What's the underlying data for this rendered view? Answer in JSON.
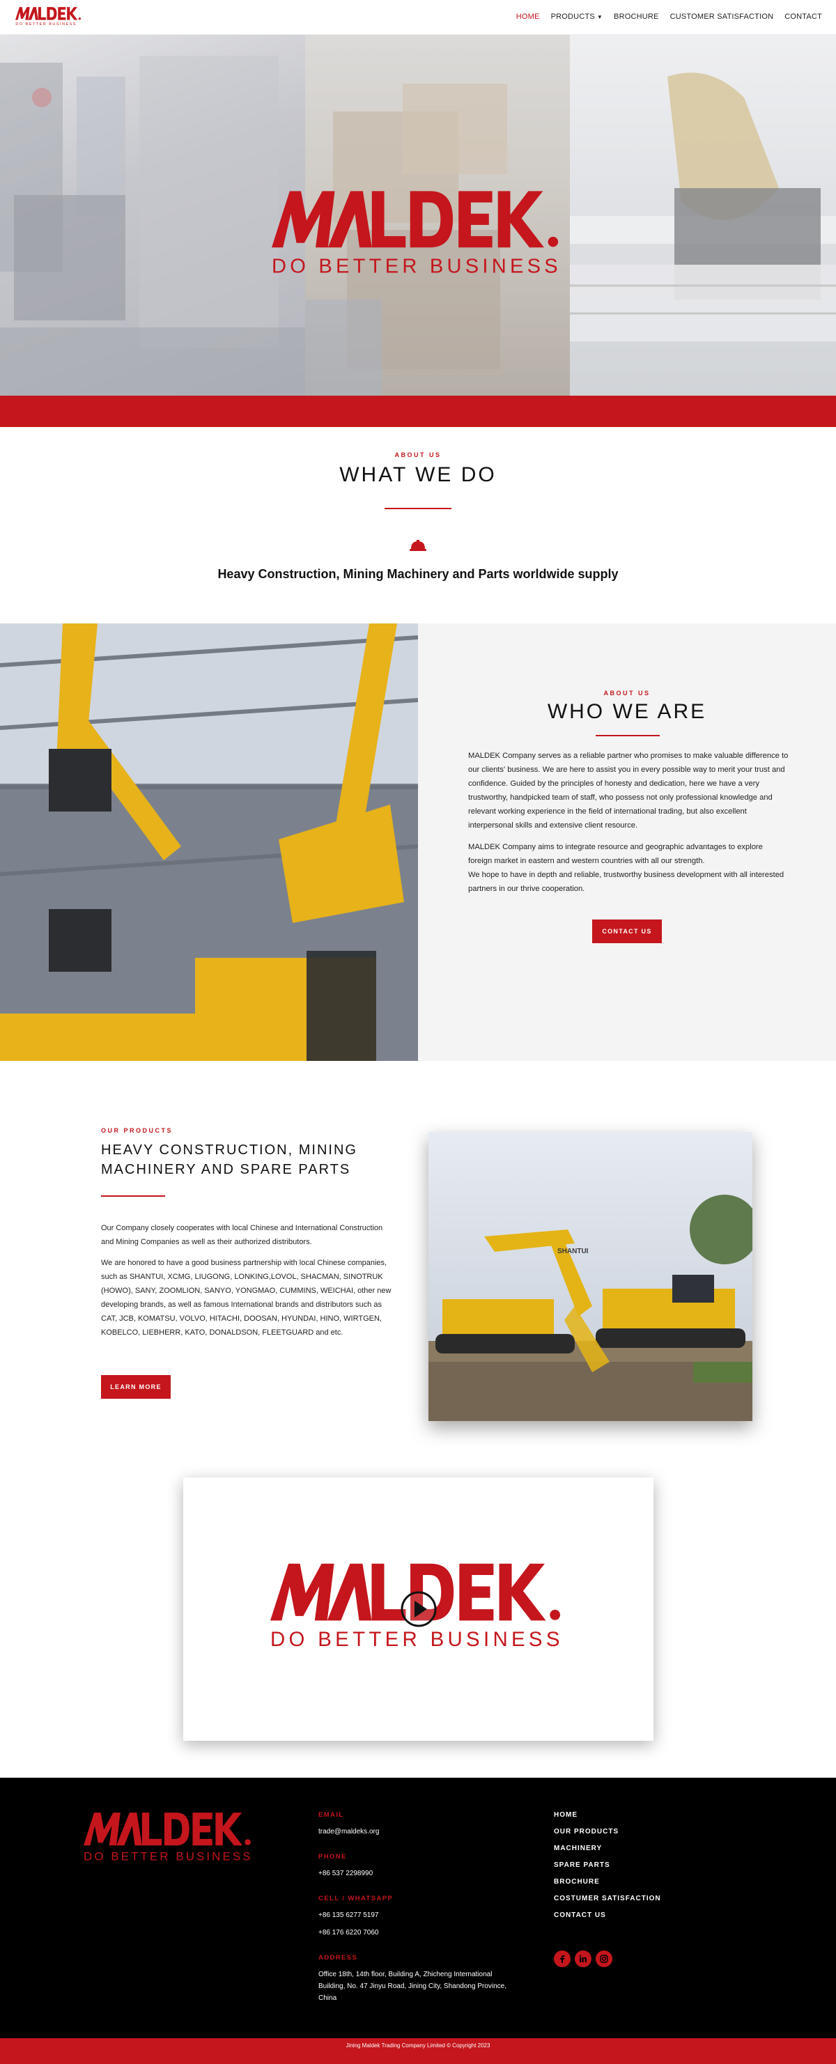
{
  "brand": {
    "logo_text": "MALDEK",
    "logo_tagline": "DO BETTER BUSINESS",
    "accent_color": "#c4161c"
  },
  "nav": {
    "items": [
      {
        "label": "HOME",
        "active": true
      },
      {
        "label": "PRODUCTS",
        "has_dropdown": true
      },
      {
        "label": "BROCHURE"
      },
      {
        "label": "CUSTOMER SATISFACTION"
      },
      {
        "label": "CONTACT"
      }
    ]
  },
  "about": {
    "eyebrow": "ABOUT US",
    "title": "WHAT WE DO",
    "icon": "helmet-icon",
    "tagline": "Heavy Construction, Mining Machinery and Parts worldwide supply"
  },
  "who": {
    "eyebrow": "ABOUT US",
    "title": "WHO WE ARE",
    "paragraphs": [
      "MALDEK Company serves as a reliable partner who promises to make valuable difference to our clients' business. We are here to assist you in every possible way to merit your trust and confidence. Guided by the principles of honesty and dedication, here we have a very trustworthy, handpicked team of staff, who possess not only professional knowledge and relevant working experience in the field of international trading, but also excellent interpersonal skills and extensive client resource.",
      "MALDEK Company aims to integrate resource and geographic advantages to explore foreign market in eastern and western countries with all our strength.",
      "We hope to have in depth and reliable, trustworthy business development with all interested partners in our thrive cooperation."
    ],
    "button": "CONTACT US"
  },
  "products": {
    "eyebrow": "OUR PRODUCTS",
    "title": "HEAVY CONSTRUCTION, MINING MACHINERY AND SPARE PARTS",
    "paragraphs": [
      "Our Company closely cooperates with local Chinese and International Construction and Mining Companies as well as their authorized distributors.",
      "We are honored to have a good business partnership with local Chinese companies, such as SHANTUI, XCMG, LIUGONG, LONKING,LOVOL, SHACMAN, SINOTRUK (HOWO), SANY, ZOOMLION, SANYO, YONGMAO, CUMMINS, WEICHAI, other new developing brands, as well as famous International brands and distributors such as CAT, JCB, KOMATSU, VOLVO, HITACHI, DOOSAN, HYUNDAI, HINO, WIRTGEN, KOBELCO, LIEBHERR, KATO, DONALDSON, FLEETGUARD and etc."
    ],
    "button": "LEARN MORE",
    "image_brand_text": "SHANTUI"
  },
  "video": {
    "play_icon": "play-icon"
  },
  "footer": {
    "email_label": "EMAIL",
    "email": "trade@maldeks.org",
    "phone_label": "PHONE",
    "phone": "+86 537 2298990",
    "cell_label": "CELL / WHATSAPP",
    "cells": [
      "+86 135 6277 5197",
      "+86 176 6220 7060"
    ],
    "address_label": "ADDRESS",
    "address": "Office 18th, 14th floor, Building A, Zhicheng International Building, No. 47 Jinyu Road, Jining City, Shandong Province, China",
    "links": [
      "HOME",
      "OUR PRODUCTS",
      "MACHINERY",
      "SPARE PARTS",
      "BROCHURE",
      "COSTUMER SATISFACTION",
      "CONTACT US"
    ],
    "socials": [
      "facebook-icon",
      "linkedin-icon",
      "instagram-icon"
    ],
    "copyright": "Jining Maldek Trading Company Limited © Copyright 2023"
  }
}
